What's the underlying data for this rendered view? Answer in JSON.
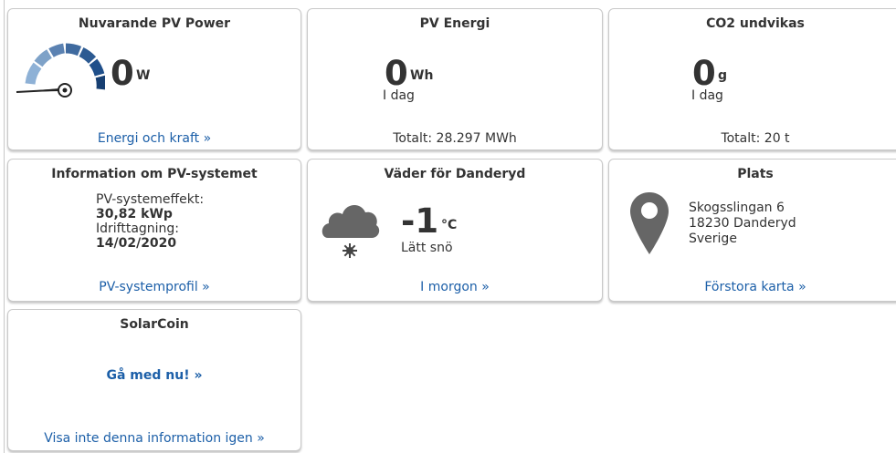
{
  "colors": {
    "accent_link": "#1c5fa8",
    "gauge_dark": "#1f4f8a",
    "gauge_light": "#8eb1d6",
    "icon_gray": "#666666"
  },
  "cards": {
    "current_power": {
      "title": "Nuvarande PV Power",
      "value": "0",
      "unit": "W",
      "link": "Energi och kraft »",
      "icon": "gauge-icon"
    },
    "energy": {
      "title": "PV Energi",
      "value": "0",
      "unit": "Wh",
      "period": "I dag",
      "total": "Totalt: 28.297 MWh"
    },
    "co2": {
      "title": "CO2 undvikas",
      "value": "0",
      "unit": "g",
      "period": "I dag",
      "total": "Totalt: 20 t"
    },
    "system_info": {
      "title": "Information om PV-systemet",
      "power_label": "PV-systemeffekt:",
      "power_value": "30,82 kWp",
      "commission_label": "Idrifttagning:",
      "commission_value": "14/02/2020",
      "link": "PV-systemprofil »"
    },
    "weather": {
      "title": "Väder för Danderyd",
      "temp": "-1",
      "unit": "°C",
      "condition": "Lätt snö",
      "link": "I morgon »",
      "icon": "cloud-snow-icon"
    },
    "location": {
      "title": "Plats",
      "street": "Skogsslingan 6",
      "city": "18230 Danderyd",
      "country": "Sverige",
      "link": "Förstora karta »",
      "icon": "map-pin-icon"
    },
    "solarcoin": {
      "title": "SolarCoin",
      "join": "Gå med nu! »",
      "dismiss": "Visa inte denna information igen »"
    }
  }
}
